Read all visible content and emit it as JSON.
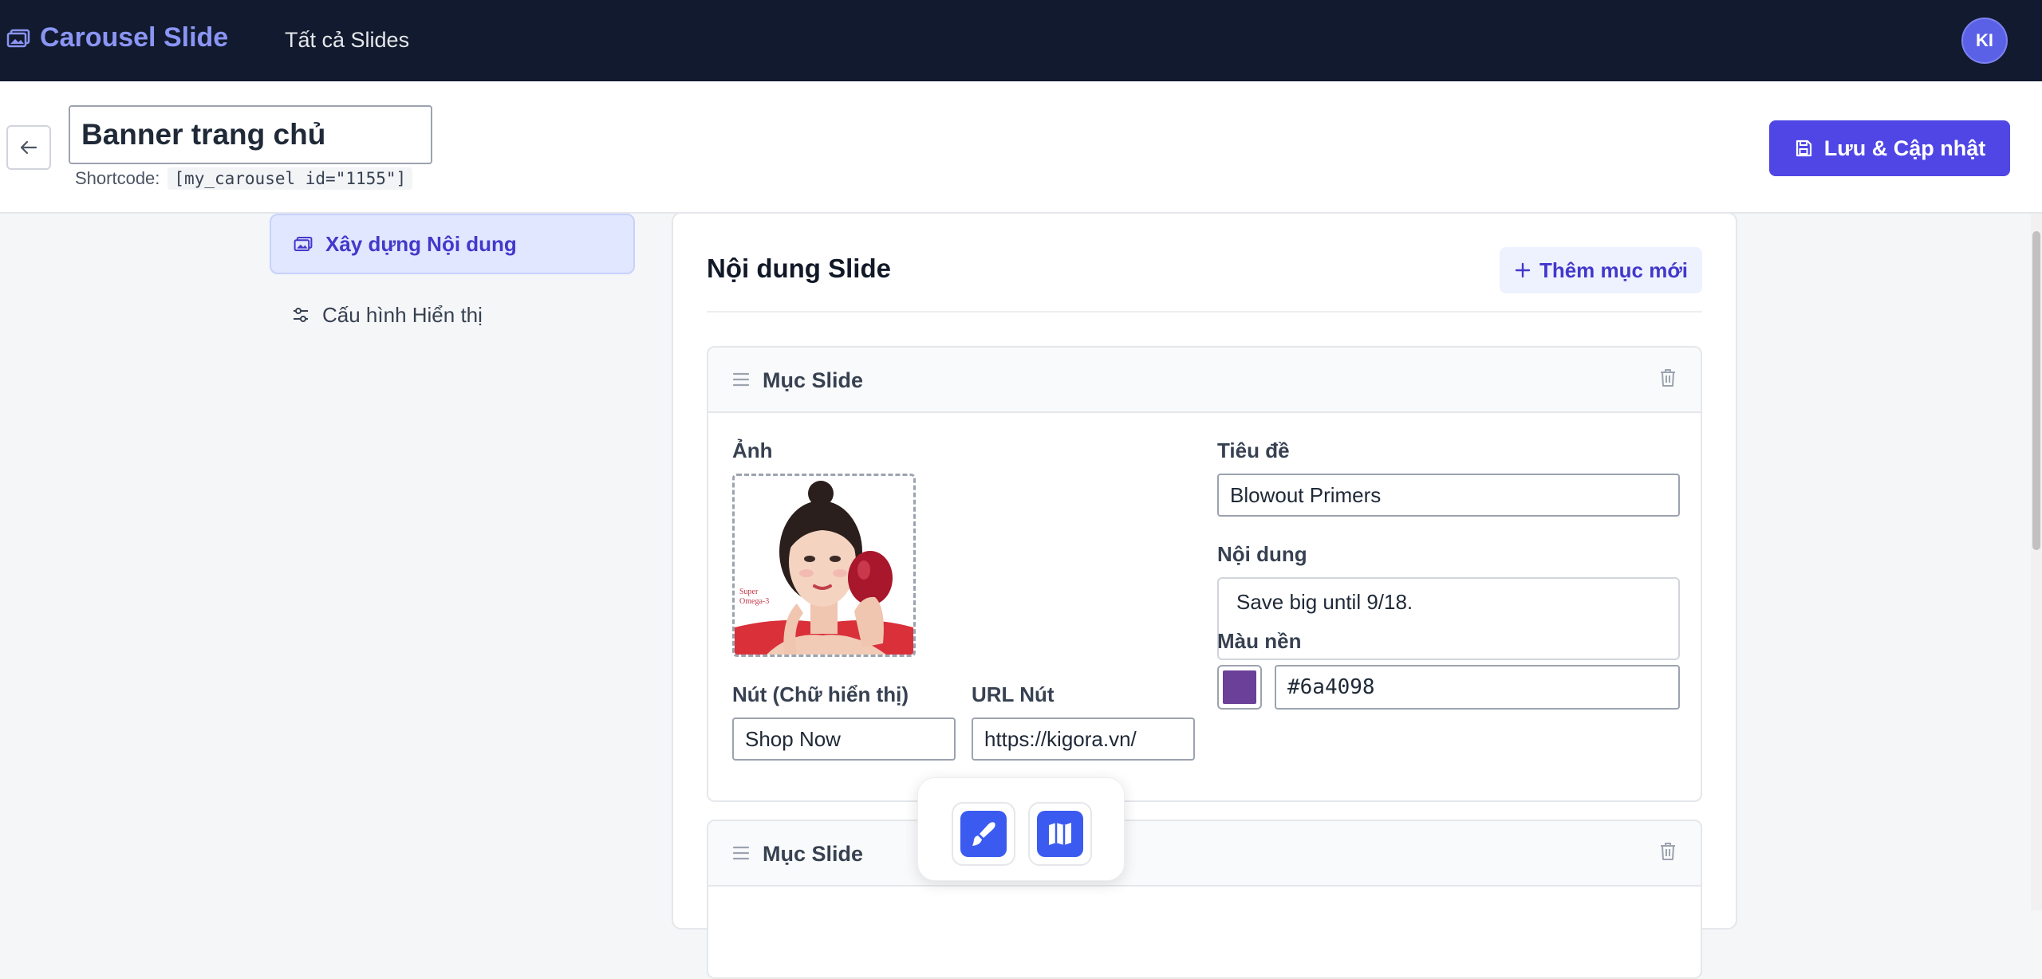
{
  "topbar": {
    "brand": "Carousel Slide",
    "nav_all_slides": "Tất cả Slides",
    "avatar_initials": "KI"
  },
  "header": {
    "title_value": "Banner trang chủ",
    "shortcode_label": "Shortcode:",
    "shortcode_value": "[my_carousel id=\"1155\"]",
    "save_label": "Lưu & Cập nhật"
  },
  "sidebar": {
    "items": [
      {
        "label": "Xây dựng Nội dung",
        "icon": "images-icon",
        "active": true
      },
      {
        "label": "Cấu hình Hiển thị",
        "icon": "sliders-icon",
        "active": false
      }
    ]
  },
  "main": {
    "title": "Nội dung Slide",
    "add_label": "Thêm mục mới",
    "slides": [
      {
        "header": "Mục Slide",
        "image_label": "Ảnh",
        "title_label": "Tiêu đề",
        "title_value": "Blowout Primers",
        "content_label": "Nội dung",
        "content_value": "Save big until 9/18.",
        "button_text_label": "Nút (Chữ hiển thị)",
        "button_text_value": "Shop Now",
        "button_url_label": "URL Nút",
        "button_url_value": "https://kigora.vn/",
        "bg_color_label": "Màu nền",
        "bg_color_value": "#6a4098"
      },
      {
        "header": "Mục Slide"
      }
    ]
  },
  "image_overlay_text": [
    "Super",
    "Omega-3"
  ],
  "colors": {
    "topbar_bg": "#111a2e",
    "brand": "#8b95f3",
    "primary": "#4f46e5",
    "active_bg": "#e0e7ff",
    "swatch": "#6a4098"
  },
  "floating_toolbar": {
    "buttons": [
      "brush-icon",
      "map-icon"
    ]
  }
}
